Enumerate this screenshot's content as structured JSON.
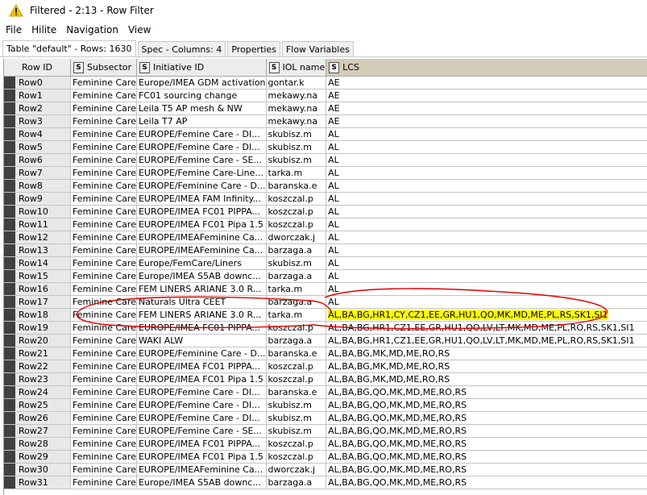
{
  "window": {
    "title": "Filtered - 2:13 - Row Filter",
    "icon": "warning-triangle-icon",
    "icon_color": "#f2c200"
  },
  "menu": [
    "File",
    "Hilite",
    "Navigation",
    "View"
  ],
  "tabs": [
    {
      "label": "Table \"default\" - Rows: 1630",
      "active": true
    },
    {
      "label": "Spec - Columns: 4",
      "active": false
    },
    {
      "label": "Properties",
      "active": false
    },
    {
      "label": "Flow Variables",
      "active": false
    }
  ],
  "table": {
    "columns": [
      {
        "label": "Row ID",
        "type": ""
      },
      {
        "label": "Subsector",
        "type": "S"
      },
      {
        "label": "Initiative ID",
        "type": "S"
      },
      {
        "label": "IOL name",
        "type": "S"
      },
      {
        "label": "LCS",
        "type": "S"
      }
    ],
    "rows": [
      [
        "Row0",
        "Feminine Care",
        "Europe/IMEA GDM activation",
        "gontar.k",
        "AE"
      ],
      [
        "Row1",
        "Feminine Care",
        "FC01 sourcing change",
        "mekawy.na",
        "AE"
      ],
      [
        "Row2",
        "Feminine Care",
        "Leila T5 AP mesh & NW",
        "mekawy.na",
        "AE"
      ],
      [
        "Row3",
        "Feminine Care",
        "Leila T7 AP",
        "mekawy.na",
        "AE"
      ],
      [
        "Row4",
        "Feminine Care",
        "EUROPE/Femine Care - DI...",
        "skubisz.m",
        "AL"
      ],
      [
        "Row5",
        "Feminine Care",
        "EUROPE/Femine Care - DI...",
        "skubisz.m",
        "AL"
      ],
      [
        "Row6",
        "Feminine Care",
        "EUROPE/Femine Care - SE...",
        "skubisz.m",
        "AL"
      ],
      [
        "Row7",
        "Feminine Care",
        "EUROPE/Femine Care-Line...",
        "tarka.m",
        "AL"
      ],
      [
        "Row8",
        "Feminine Care",
        "EUROPE/Feminine Care - D...",
        "baranska.e",
        "AL"
      ],
      [
        "Row9",
        "Feminine Care",
        "EUROPE/IMEA FAM Infinity...",
        "koszczal.p",
        "AL"
      ],
      [
        "Row10",
        "Feminine Care",
        "EUROPE/IMEA FC01 PIPPA...",
        "koszczal.p",
        "AL"
      ],
      [
        "Row11",
        "Feminine Care",
        "EUROPE/IMEA FC01 Pipa 1.5",
        "koszczal.p",
        "AL"
      ],
      [
        "Row12",
        "Feminine Care",
        "EUROPE/IMEAFeminine Ca...",
        "dworczak.j",
        "AL"
      ],
      [
        "Row13",
        "Feminine Care",
        "EUROPE/IMEAFeminine Ca...",
        "barzaga.a",
        "AL"
      ],
      [
        "Row14",
        "Feminine Care",
        "Europe/FemCare/Liners",
        "skubisz.m",
        "AL"
      ],
      [
        "Row15",
        "Feminine Care",
        "Europe/IMEA S5AB downc...",
        "barzaga.a",
        "AL"
      ],
      [
        "Row16",
        "Feminine Care",
        "FEM LINERS ARIANE 3.0 R...",
        "tarka.m",
        "AL"
      ],
      [
        "Row17",
        "Feminine Care",
        "Naturals Ultra CEET",
        "barzaga.a",
        "AL"
      ],
      [
        "Row18",
        "Feminine Care",
        "FEM LINERS ARIANE 3.0 R...",
        "tarka.m",
        "AL,BA,BG,HR1,CY,CZ1,EE,GR,HU1,QO,MK,MD,ME,PL,RS,SK1,SI1"
      ],
      [
        "Row19",
        "Feminine Care",
        "EUROPE/IMEA FC01 PIPPA...",
        "koszczal.p",
        "AL,BA,BG,HR1,CZ1,EE,GR,HU1,QO,LV,LT,MK,MD,ME,PL,RO,RS,SK1,SI1"
      ],
      [
        "Row20",
        "Feminine Care",
        "WAKI ALW",
        "barzaga.a",
        "AL,BA,BG,HR1,CZ1,EE,GR,HU1,QO,LV,LT,MK,MD,ME,PL,RO,RS,SK1,SI1"
      ],
      [
        "Row21",
        "Feminine Care",
        "EUROPE/Feminine Care - D...",
        "baranska.e",
        "AL,BA,BG,MK,MD,ME,RO,RS"
      ],
      [
        "Row22",
        "Feminine Care",
        "EUROPE/IMEA FC01 PIPPA...",
        "koszczal.p",
        "AL,BA,BG,MK,MD,ME,RO,RS"
      ],
      [
        "Row23",
        "Feminine Care",
        "EUROPE/IMEA FC01 Pipa 1.5",
        "koszczal.p",
        "AL,BA,BG,MK,MD,ME,RO,RS"
      ],
      [
        "Row24",
        "Feminine Care",
        "EUROPE/Femine Care - DI...",
        "baranska.e",
        "AL,BA,BG,QO,MK,MD,ME,RO,RS"
      ],
      [
        "Row25",
        "Feminine Care",
        "EUROPE/Femine Care - DI...",
        "skubisz.m",
        "AL,BA,BG,QO,MK,MD,ME,RO,RS"
      ],
      [
        "Row26",
        "Feminine Care",
        "EUROPE/Femine Care - DI...",
        "skubisz.m",
        "AL,BA,BG,QO,MK,MD,ME,RO,RS"
      ],
      [
        "Row27",
        "Feminine Care",
        "EUROPE/Femine Care - SE...",
        "skubisz.m",
        "AL,BA,BG,QO,MK,MD,ME,RO,RS"
      ],
      [
        "Row28",
        "Feminine Care",
        "EUROPE/IMEA FC01 PIPPA...",
        "koszczal.p",
        "AL,BA,BG,QO,MK,MD,ME,RO,RS"
      ],
      [
        "Row29",
        "Feminine Care",
        "EUROPE/IMEA FC01 Pipa 1.5",
        "koszczal.p",
        "AL,BA,BG,QO,MK,MD,ME,RO,RS"
      ],
      [
        "Row30",
        "Feminine Care",
        "EUROPE/IMEAFeminine Ca...",
        "dworczak.j",
        "AL,BA,BG,QO,MK,MD,ME,RO,RS"
      ],
      [
        "Row31",
        "Feminine Care",
        "Europe/IMEA S5AB downc...",
        "barzaga.a",
        "AL,BA,BG,QO,MK,MD,ME,RO,RS"
      ]
    ],
    "highlighted_row": "Row18",
    "highlight_color": "#ffff00",
    "annotation_color": "#e00000"
  }
}
